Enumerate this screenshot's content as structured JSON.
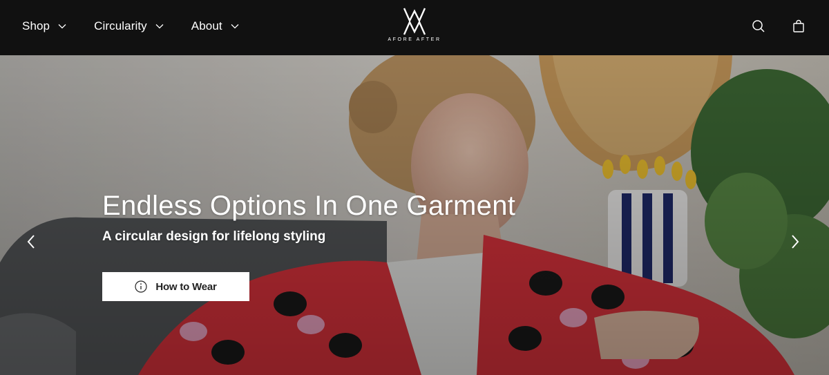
{
  "header": {
    "nav": [
      {
        "label": "Shop"
      },
      {
        "label": "Circularity"
      },
      {
        "label": "About"
      }
    ],
    "logo_text": "AFORE AFTER",
    "icons": {
      "search": "search-icon",
      "bag": "shopping-bag-icon"
    }
  },
  "hero": {
    "title": "Endless Options In One Garment",
    "subtitle": "A circular design for lifelong styling",
    "cta_label": "How to Wear",
    "cta_icon": "info-icon",
    "prev_icon": "chevron-left-icon",
    "next_icon": "chevron-right-icon"
  },
  "colors": {
    "header_bg": "#111111",
    "text_light": "#ffffff",
    "cta_bg": "#ffffff"
  }
}
